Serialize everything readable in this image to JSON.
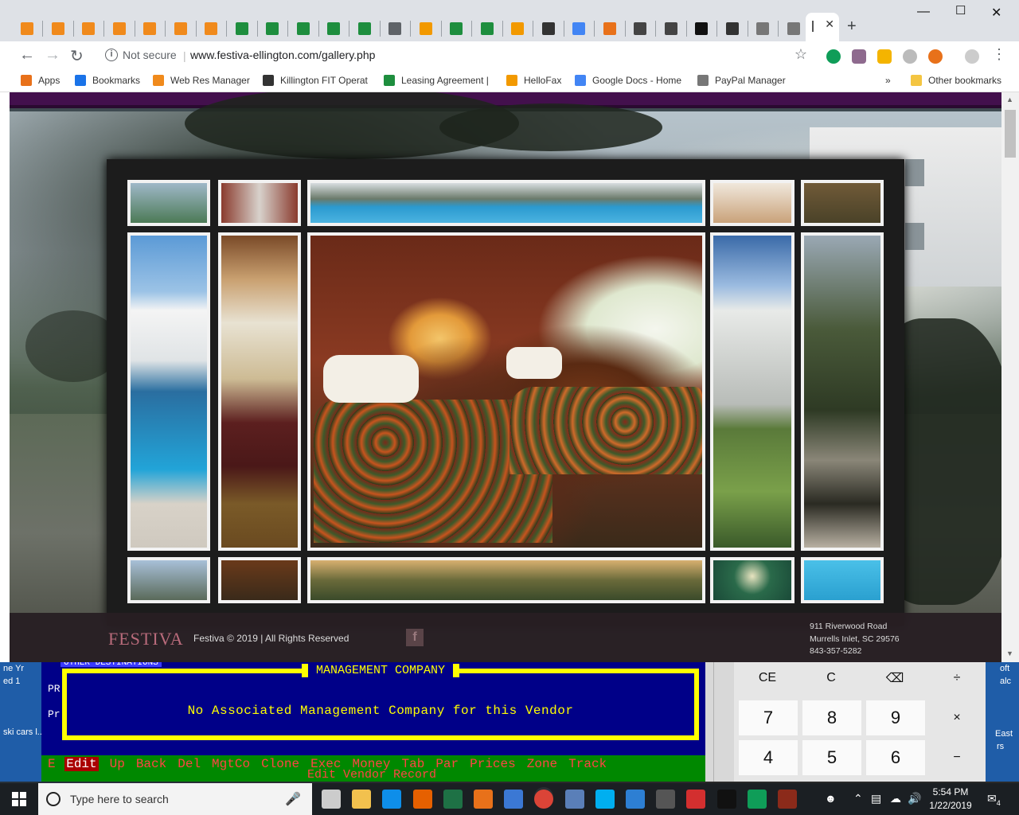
{
  "browser": {
    "url": "www.festiva-ellington.com/gallery.php",
    "security_label": "Not secure",
    "new_tab_symbol": "+",
    "close_tab_symbol": "✕",
    "tabs": [
      {
        "icon": "festiva-icon",
        "color": "#f08a1c"
      },
      {
        "icon": "festiva-icon",
        "color": "#f08a1c"
      },
      {
        "icon": "festiva-icon",
        "color": "#f08a1c"
      },
      {
        "icon": "festiva-icon",
        "color": "#f08a1c"
      },
      {
        "icon": "festiva-icon",
        "color": "#f08a1c"
      },
      {
        "icon": "festiva-icon",
        "color": "#f08a1c"
      },
      {
        "icon": "festiva-icon",
        "color": "#f08a1c"
      },
      {
        "icon": "sheets-icon",
        "color": "#1e8e3e"
      },
      {
        "icon": "sheets-icon",
        "color": "#1e8e3e"
      },
      {
        "icon": "sheets-icon",
        "color": "#1e8e3e"
      },
      {
        "icon": "sheets-icon",
        "color": "#1e8e3e"
      },
      {
        "icon": "sheets-icon",
        "color": "#1e8e3e"
      },
      {
        "icon": "home-icon",
        "color": "#5f6368"
      },
      {
        "icon": "app-icon",
        "color": "#f29900"
      },
      {
        "icon": "sheets-icon",
        "color": "#1e8e3e"
      },
      {
        "icon": "sheets-icon",
        "color": "#1e8e3e"
      },
      {
        "icon": "app-icon",
        "color": "#f29900"
      },
      {
        "icon": "wr-icon",
        "color": "#333333"
      },
      {
        "icon": "google-icon",
        "color": "#4285f4"
      },
      {
        "icon": "pdf-icon",
        "color": "#e8711a"
      },
      {
        "icon": "car-icon",
        "color": "#444444"
      },
      {
        "icon": "car-icon",
        "color": "#444444"
      },
      {
        "icon": "h-icon",
        "color": "#111111"
      },
      {
        "icon": "wr-icon",
        "color": "#333333"
      },
      {
        "icon": "doc-icon",
        "color": "#777777"
      },
      {
        "icon": "doc-icon",
        "color": "#777777"
      }
    ],
    "bookmarks": [
      {
        "label": "Apps",
        "color": "#e8711a"
      },
      {
        "label": "Bookmarks",
        "color": "#1a73e8"
      },
      {
        "label": "Web Res Manager",
        "color": "#f08a1c"
      },
      {
        "label": "Killington FIT Operat",
        "color": "#333333"
      },
      {
        "label": "Leasing Agreement |",
        "color": "#1e8e3e"
      },
      {
        "label": "HelloFax",
        "color": "#f29900"
      },
      {
        "label": "Google Docs - Home",
        "color": "#4285f4"
      },
      {
        "label": "PayPal Manager",
        "color": "#777777"
      }
    ],
    "more_bookmarks": "»",
    "other_bookmarks": "Other bookmarks"
  },
  "site": {
    "logo": "FESTIVA",
    "copyright": "Festiva © 2019 | All Rights Reserved",
    "fb_letter": "f",
    "address_line1": "911 Riverwood Road",
    "address_line2": "Murrells Inlet, SC 29576",
    "phone": "843-357-5282"
  },
  "terminal": {
    "top_label": "OTHER DESTINATIONS",
    "prefix1": "PR",
    "prefix2": "Pr",
    "dialog_title": "MANAGEMENT COMPANY",
    "dialog_message": "No Associated Management Company for this Vendor",
    "menu_prefix": "E",
    "menu": [
      "Edit",
      "Up",
      "Back",
      "Del",
      "MgtCo",
      "Clone",
      "Exec",
      "Money",
      "Tab",
      "Par",
      "Prices",
      "Zone",
      "Track"
    ],
    "status": "Edit Vendor Record"
  },
  "background": {
    "left_line1": "ne Yr",
    "left_line2": "ed 1",
    "left_line3": "ski cars l...",
    "right_line1": "oft",
    "right_line2": "alc",
    "right_line3": "East",
    "right_line4": "rs"
  },
  "calculator": {
    "keys": [
      "CE",
      "C",
      "⌫",
      "÷",
      "7",
      "8",
      "9",
      "×",
      "4",
      "5",
      "6",
      "−"
    ]
  },
  "taskbar": {
    "search_placeholder": "Type here to search",
    "time": "5:54 PM",
    "date": "1/22/2019",
    "notification_count": "4",
    "apps": [
      {
        "icon": "task-view-icon",
        "color": "#cccccc"
      },
      {
        "icon": "file-explorer-icon",
        "color": "#f2c14e"
      },
      {
        "icon": "teamviewer-icon",
        "color": "#0e8ee9"
      },
      {
        "icon": "firefox-icon",
        "color": "#e66000"
      },
      {
        "icon": "excel-icon",
        "color": "#1e7145"
      },
      {
        "icon": "app-icon",
        "color": "#e8711a"
      },
      {
        "icon": "app-icon",
        "color": "#3b78d4"
      },
      {
        "icon": "chrome-icon",
        "color": "#db4437"
      },
      {
        "icon": "terminal-icon",
        "color": "#5a7fb8"
      },
      {
        "icon": "skype-icon",
        "color": "#00aff0"
      },
      {
        "icon": "app-icon",
        "color": "#2d7fd3"
      },
      {
        "icon": "calculator-icon",
        "color": "#555555"
      },
      {
        "icon": "acrobat-icon",
        "color": "#d32f2f"
      },
      {
        "icon": "cmd-icon",
        "color": "#111111"
      },
      {
        "icon": "hangouts-icon",
        "color": "#0f9d58"
      },
      {
        "icon": "app-icon",
        "color": "#8b2a1a"
      }
    ]
  }
}
